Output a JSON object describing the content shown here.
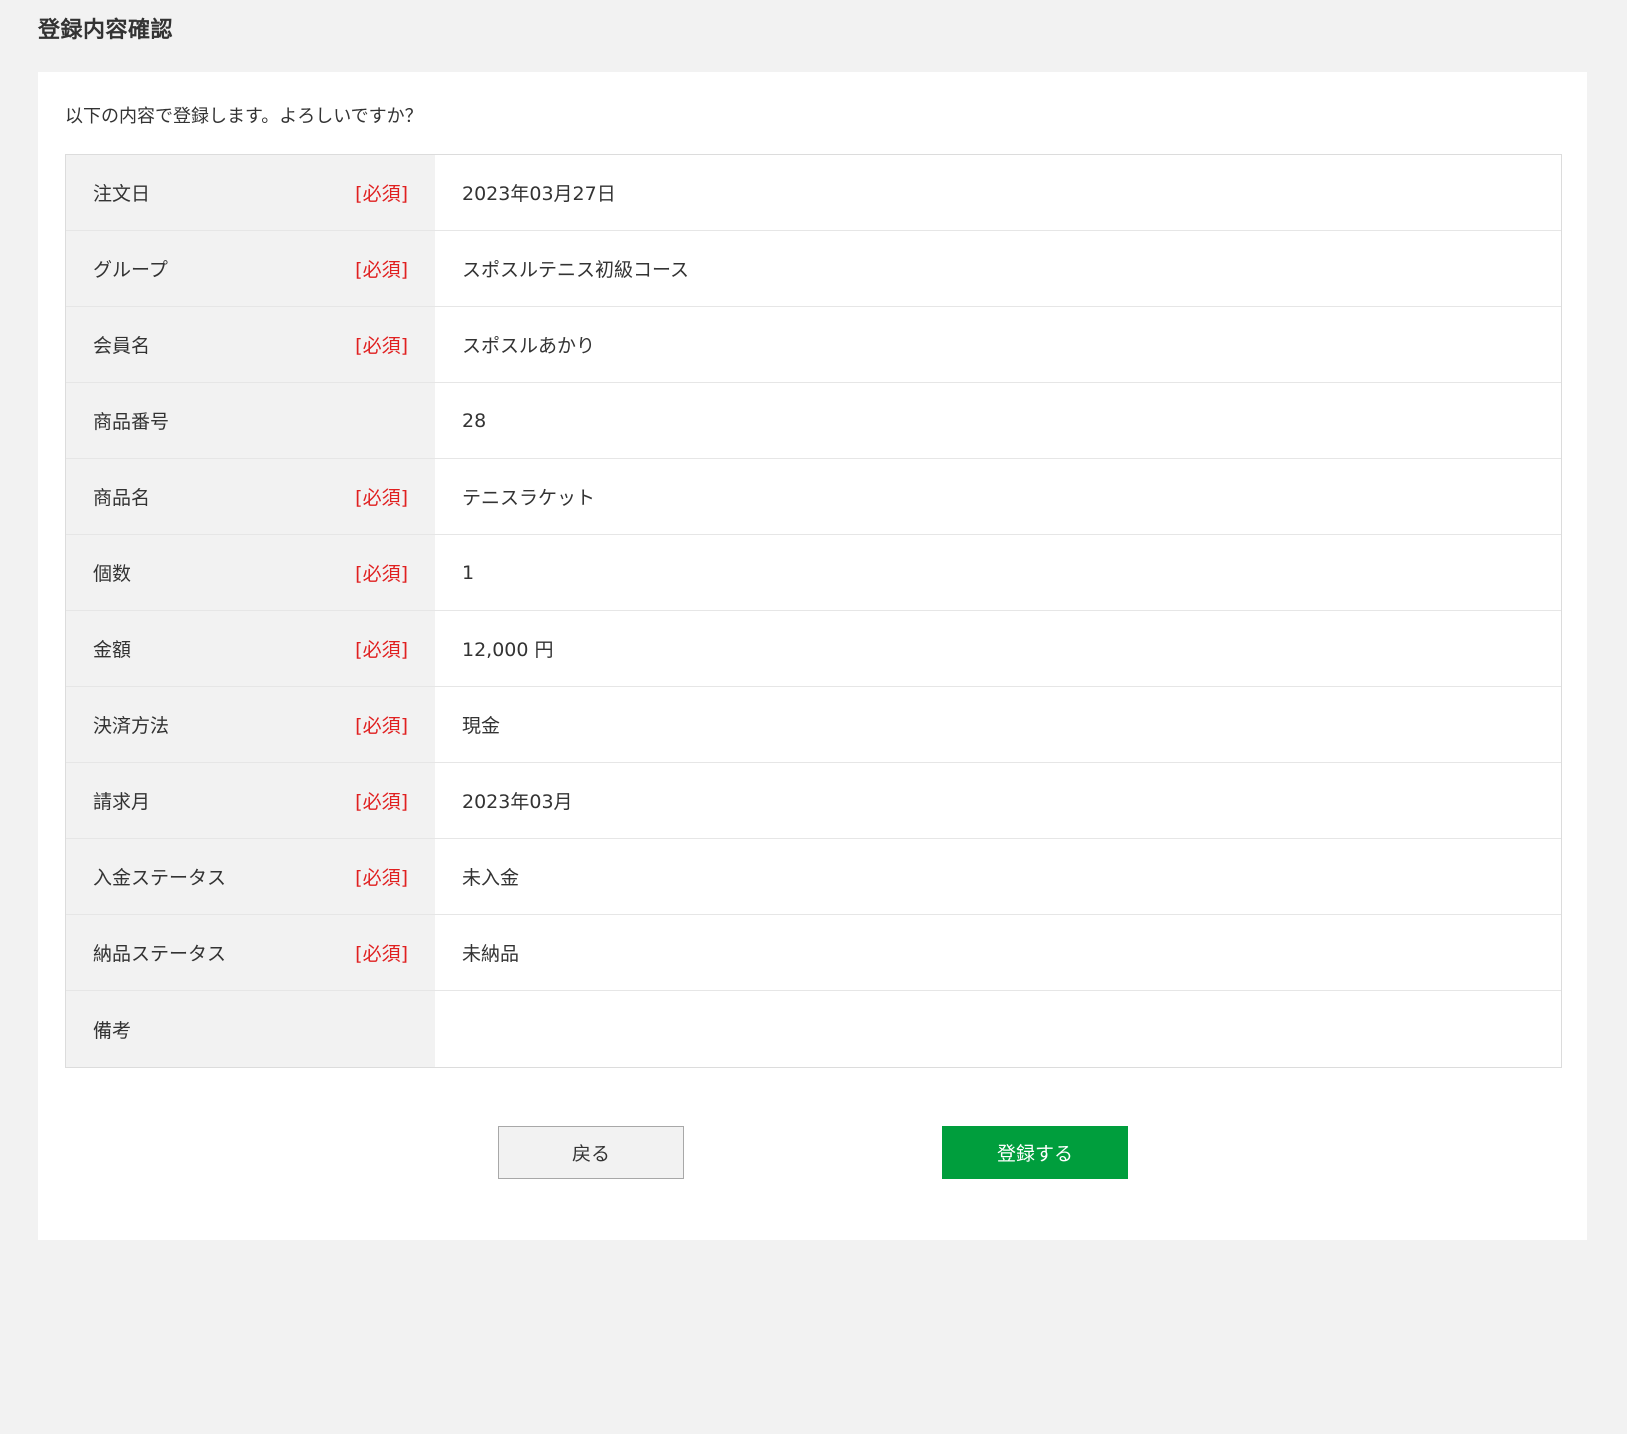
{
  "page": {
    "title": "登録内容確認",
    "intro": "以下の内容で登録します。よろしいですか？"
  },
  "required_label": "[必須]",
  "rows": [
    {
      "label": "注文日",
      "required": true,
      "value": "2023年03月27日"
    },
    {
      "label": "グループ",
      "required": true,
      "value": "スポスルテニス初級コース"
    },
    {
      "label": "会員名",
      "required": true,
      "value": "スポスルあかり"
    },
    {
      "label": "商品番号",
      "required": false,
      "value": "28"
    },
    {
      "label": "商品名",
      "required": true,
      "value": "テニスラケット"
    },
    {
      "label": "個数",
      "required": true,
      "value": "1"
    },
    {
      "label": "金額",
      "required": true,
      "value": "12,000 円"
    },
    {
      "label": "決済方法",
      "required": true,
      "value": "現金"
    },
    {
      "label": "請求月",
      "required": true,
      "value": "2023年03月"
    },
    {
      "label": "入金ステータス",
      "required": true,
      "value": "未入金"
    },
    {
      "label": "納品ステータス",
      "required": true,
      "value": "未納品"
    },
    {
      "label": "備考",
      "required": false,
      "value": ""
    }
  ],
  "buttons": {
    "back_label": "戻る",
    "submit_label": "登録する"
  },
  "colors": {
    "required": "#e02020",
    "submit": "#009e3d",
    "label_bg": "#f2f2f2"
  }
}
